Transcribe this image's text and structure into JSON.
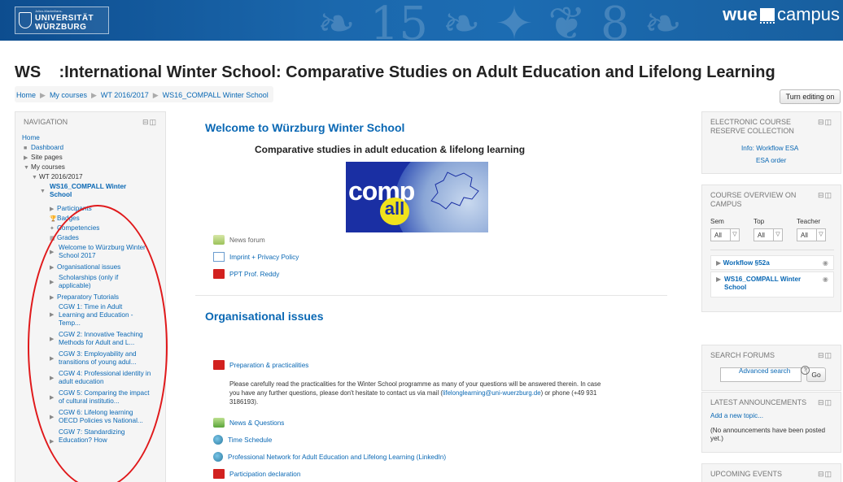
{
  "header": {
    "uni_logo": {
      "small": "Julius-Maximilians-",
      "line1": "UNIVERSITÄT",
      "line2": "WÜRZBURG"
    },
    "wue_logo": {
      "bold": "wue",
      "light": "campus"
    }
  },
  "page_title": "WS    :International Winter School: Comparative Studies on Adult Education and Lifelong Learning",
  "breadcrumb": [
    "Home",
    "My courses",
    "WT 2016/2017",
    "WS16_COMPALL Winter School"
  ],
  "turn_editing_label": "Turn editing on",
  "navigation": {
    "title": "NAVIGATION",
    "home": "Home",
    "dashboard": "Dashboard",
    "site_pages": "Site pages",
    "my_courses": "My courses",
    "term": "WT 2016/2017",
    "course": "WS16_COMPALL Winter School",
    "participants": "Participants",
    "badges": "Badges",
    "competencies": "Competencies",
    "grades": "Grades",
    "sections": [
      "Welcome to Würzburg Winter School 2017",
      "Organisational issues",
      "Scholarships (only if applicable)",
      "Preparatory Tutorials",
      "CGW 1: Time in Adult Learning and Education - Temp...",
      "CGW 2: Innovative Teaching Methods for Adult and L...",
      "CGW 3: Employability and transitions of young adul...",
      "CGW 4: Professional identity in adult education",
      "CGW 5: Comparing the impact of cultural institutio...",
      "CGW 6: Lifelong learning OECD Policies vs National...",
      "CGW 7: Standardizing Education? How"
    ]
  },
  "main": {
    "welcome_title": "Welcome to Würzburg Winter School",
    "subtitle": "Comparative studies in adult education & lifelong learning",
    "logo": {
      "comp": "comp",
      "all": "all"
    },
    "welcome_activities": [
      "News forum",
      "Imprint + Privacy Policy",
      "PPT Prof. Reddy"
    ],
    "org_title": "Organisational issues",
    "org_first": "Preparation & practicalities",
    "org_desc_1": "Please carefully read the practicalities for the Winter School programme as many of your questions will be answered therein. In case you have any further questions, please don't hesitate to contact us via mail (",
    "org_desc_email": "lifelonglearning@uni-wuerzburg.de",
    "org_desc_2": ") or phone (+49 931 3186193).",
    "org_activities": [
      "News & Questions",
      "Time Schedule",
      "Professional Network for Adult Education and Lifelong Learning (LinkedIn)",
      "Participation declaration"
    ]
  },
  "right": {
    "esa": {
      "title": "ELECTRONIC COURSE RESERVE COLLECTION",
      "link1": "Info: Workflow ESA",
      "link2": "ESA order"
    },
    "overview": {
      "title": "COURSE OVERVIEW ON CAMPUS",
      "labels": [
        "Sem",
        "Top",
        "Teacher"
      ],
      "selects": [
        "All",
        "All",
        "All"
      ],
      "courses": [
        "Workflow §52a",
        "WS16_COMPALL Winter School"
      ]
    },
    "search": {
      "title": "SEARCH FORUMS",
      "go": "Go",
      "advanced": "Advanced search"
    },
    "announcements": {
      "title": "LATEST ANNOUNCEMENTS",
      "add": "Add a new topic...",
      "none": "(No announcements have been posted yet.)"
    },
    "events": {
      "title": "UPCOMING EVENTS"
    }
  },
  "colors": {
    "header_blue": "#1b68ad",
    "link": "#0a68b4",
    "annotation_red": "#e0191b"
  }
}
